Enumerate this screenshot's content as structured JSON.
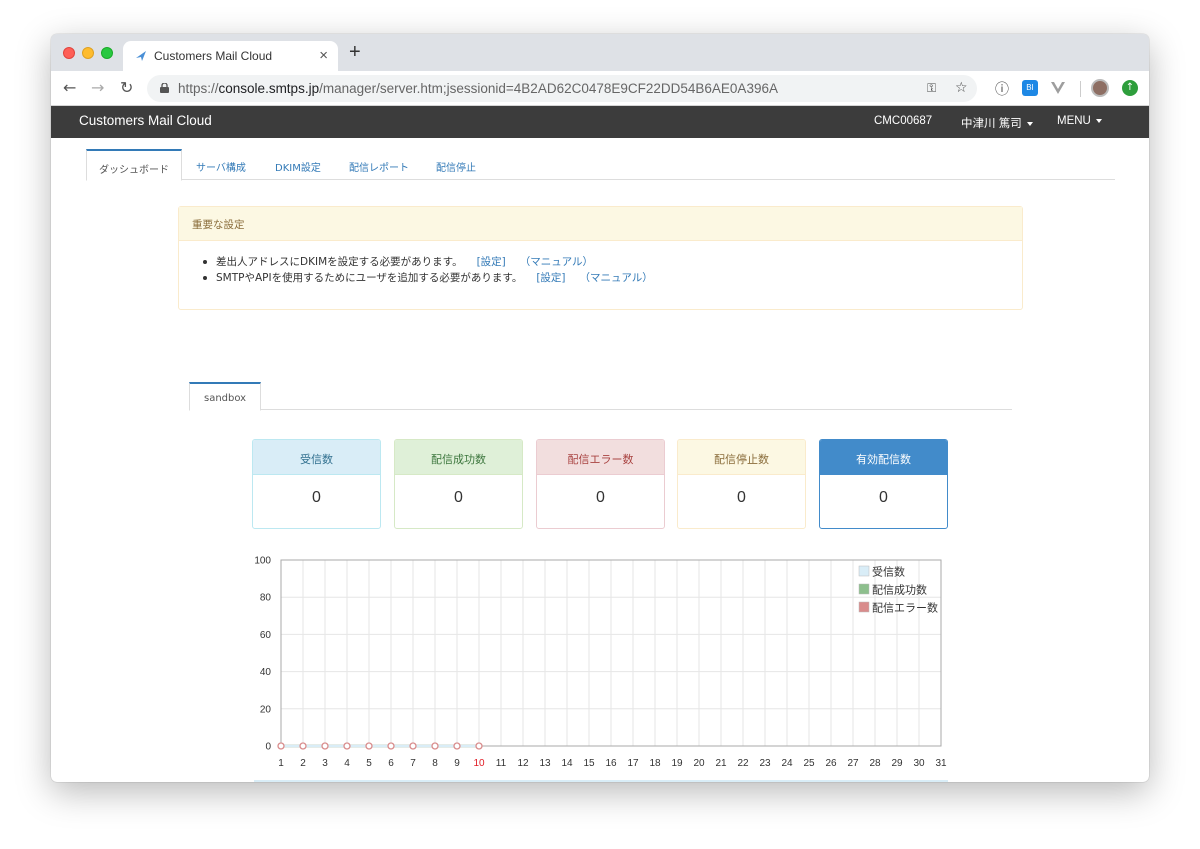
{
  "browser": {
    "tab_title": "Customers Mail Cloud",
    "tab_close": "×",
    "new_tab": "+",
    "url_scheme": "https://",
    "url_host": "console.smtps.jp",
    "url_path": "/manager/server.htm;jsessionid=4B2AD62C0478E9CF22DD54B6AE0A396A",
    "ext_bi": "BI"
  },
  "appbar": {
    "brand": "Customers Mail Cloud",
    "account_id": "CMC00687",
    "user_name": "中津川 篤司",
    "menu": "MENU"
  },
  "main_tabs": [
    "ダッシュボード",
    "サーバ構成",
    "DKIM設定",
    "配信レポート",
    "配信停止"
  ],
  "alert": {
    "title": "重要な設定",
    "items": [
      {
        "text": "差出人アドレスにDKIMを設定する必要があります。",
        "link1": "[設定]",
        "link2": "（マニュアル）"
      },
      {
        "text": "SMTPやAPIを使用するためにユーザを追加する必要があります。",
        "link1": "[設定]",
        "link2": "（マニュアル）"
      }
    ]
  },
  "server_tab": "sandbox",
  "stats": [
    {
      "label": "受信数",
      "value": "0",
      "head_bg": "#d9edf7",
      "head_color": "#31708f",
      "border": "#bce8f1"
    },
    {
      "label": "配信成功数",
      "value": "0",
      "head_bg": "#dff0d8",
      "head_color": "#3c763d",
      "border": "#d6e9c6"
    },
    {
      "label": "配信エラー数",
      "value": "0",
      "head_bg": "#f2dede",
      "head_color": "#a94442",
      "border": "#ebccd1"
    },
    {
      "label": "配信停止数",
      "value": "0",
      "head_bg": "#fcf8e3",
      "head_color": "#8a6d3b",
      "border": "#faebcc"
    },
    {
      "label": "有効配信数",
      "value": "0",
      "head_bg": "#428bca",
      "head_color": "#ffffff",
      "border": "#428bca"
    }
  ],
  "chart_data": {
    "type": "line",
    "x": [
      1,
      2,
      3,
      4,
      5,
      6,
      7,
      8,
      9,
      10,
      11,
      12,
      13,
      14,
      15,
      16,
      17,
      18,
      19,
      20,
      21,
      22,
      23,
      24,
      25,
      26,
      27,
      28,
      29,
      30,
      31
    ],
    "ylim": [
      0,
      100
    ],
    "yticks": [
      0,
      20,
      40,
      60,
      80,
      100
    ],
    "grid": true,
    "legend_position": "top-right",
    "highlight_x": 10,
    "series": [
      {
        "name": "受信数",
        "color": "#d9edf7",
        "values": [
          0,
          0,
          0,
          0,
          0,
          0,
          0,
          0,
          0,
          0
        ]
      },
      {
        "name": "配信成功数",
        "color": "#8dbf8d",
        "values": [
          0,
          0,
          0,
          0,
          0,
          0,
          0,
          0,
          0,
          0
        ]
      },
      {
        "name": "配信エラー数",
        "color": "#d98c8c",
        "values": [
          0,
          0,
          0,
          0,
          0,
          0,
          0,
          0,
          0,
          0
        ]
      }
    ]
  }
}
